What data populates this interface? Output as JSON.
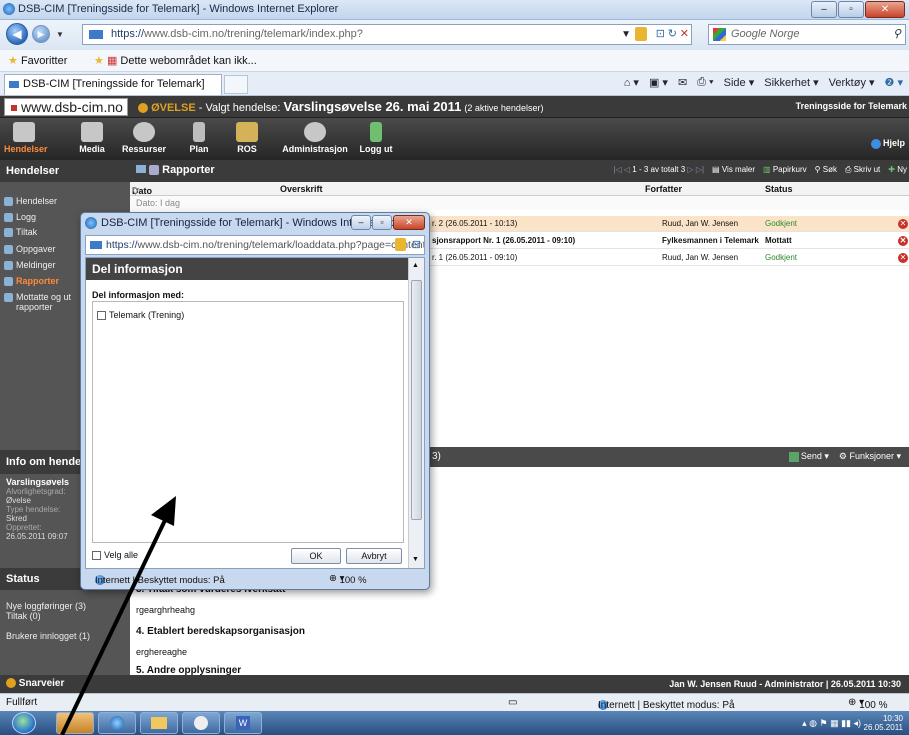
{
  "browser": {
    "window_title": "DSB-CIM [Treningsside for Telemark] - Windows Internet Explorer",
    "url_scheme": "https://",
    "url_rest": "www.dsb-cim.no/trening/telemark/index.php?",
    "search_placeholder": "Google Norge",
    "favorites_label": "Favoritter",
    "fav_link": "Dette webområdet kan ikk...",
    "tab_label": "DSB-CIM [Treningsside for Telemark]",
    "cmd": {
      "side": "Side ▾",
      "sikkerhet": "Sikkerhet ▾",
      "verktoy": "Verktøy ▾"
    },
    "status_left": "Fullført",
    "status_zone": "Internett | Beskyttet modus: På",
    "status_zoom": "100 %"
  },
  "app": {
    "logo": "www.dsb-cim.no",
    "event_tag": "ØVELSE",
    "event_prefix": " - Valgt hendelse: ",
    "event_name": "Varslingsøvelse 26. mai 2011",
    "event_count": "(2 aktive hendelser)",
    "site_name": "Treningsside for Telemark",
    "nav": [
      {
        "label": "Hendelser"
      },
      {
        "label": "Media"
      },
      {
        "label": "Ressurser"
      },
      {
        "label": "Plan"
      },
      {
        "label": "ROS"
      },
      {
        "label": "Administrasjon"
      },
      {
        "label": "Logg ut"
      }
    ],
    "help": "Hjelp"
  },
  "sidebar": {
    "title": "Hendelser",
    "items": [
      {
        "label": "Hendelser"
      },
      {
        "label": "Logg"
      },
      {
        "label": "Tiltak"
      },
      {
        "label": "Oppgaver"
      },
      {
        "label": "Meldinger"
      },
      {
        "label": "Rapporter"
      },
      {
        "label": "Mottatte og ut"
      },
      {
        "label": "rapporter"
      }
    ],
    "info_title": "Info om hende",
    "info": {
      "name": "Varslingsøvels",
      "alvor_label": "Alvorlighetsgrad:",
      "alvor_value": "Øvelse",
      "type_label": "Type hendelse:",
      "type_value": "Skred",
      "created_label": "Opprettet:",
      "created_value": "26.05.2011 09:07"
    },
    "status_title": "Status",
    "status_items": [
      {
        "label": "Nye loggføringer (3)"
      },
      {
        "label": "Tiltak (0)"
      },
      {
        "label": "Brukere innlogget (1)"
      }
    ]
  },
  "reports": {
    "title": "Rapporter",
    "pager": "1 - 3 av totalt 3",
    "tools": {
      "vis_maler": "Vis maler",
      "papirkurv": "Papirkurv",
      "sok": "Søk",
      "skriv_ut": "Skriv ut",
      "ny": "Ny"
    },
    "columns": {
      "dato": "Dato",
      "overskrift": "Overskrift",
      "forfatter": "Forfatter",
      "status": "Status"
    },
    "group": "Dato: I dag",
    "rows": [
      {
        "overskrift": "r. 2 (26.05.2011 - 10:13)",
        "forfatter": "Ruud, Jan W. Jensen",
        "status": "Godkjent"
      },
      {
        "overskrift": "sjonsrapport Nr. 1 (26.05.2011 - 09:10)",
        "forfatter": "Fylkesmannen i Telemark",
        "status": "Mottatt"
      },
      {
        "overskrift": "r. 1 (26.05.2011 - 09:10)",
        "forfatter": "Ruud, Jan W. Jensen",
        "status": "Godkjent"
      }
    ]
  },
  "lower": {
    "head_fragment": "3)",
    "send": "Send ▾",
    "funksjoner": "Funksjoner ▾",
    "lines": [
      {
        "text": "3. Tiltak som vurderes iverksatt",
        "heading": true
      },
      {
        "text": "rgearghrheahg",
        "heading": false
      },
      {
        "text": "4. Etablert beredskapsorganisasjon",
        "heading": true
      },
      {
        "text": "erghereaghe",
        "heading": false
      },
      {
        "text": "5. Andre opplysninger",
        "heading": true
      }
    ]
  },
  "footer": {
    "snarveier": "Snarveier",
    "user": "Jan W. Jensen Ruud - Administrator | 26.05.2011 10:30"
  },
  "taskbar": {
    "time": "10:30",
    "date": "26.05.2011"
  },
  "popup": {
    "title": "DSB-CIM [Treningsside for Telemark] - Windows Internet Explorer",
    "url_scheme": "https://",
    "url_rest": "www.dsb-cim.no/trening/telemark/loaddata.php?page=content&m",
    "dialog_title": "Del informasjon",
    "share_label": "Del informasjon med:",
    "options": [
      {
        "label": "Telemark (Trening)",
        "checked": false
      }
    ],
    "select_all": "Velg alle",
    "ok": "OK",
    "cancel": "Avbryt",
    "status_zone": "Internett | Beskyttet modus: På",
    "status_zoom": "100 %"
  },
  "colors": {
    "accent_orange": "#ff8a3a",
    "app_dark": "#3b3b3b",
    "status_ok": "#2d8a2d",
    "highlight_row": "#fbe3c8",
    "delete_red": "#c9302c"
  }
}
